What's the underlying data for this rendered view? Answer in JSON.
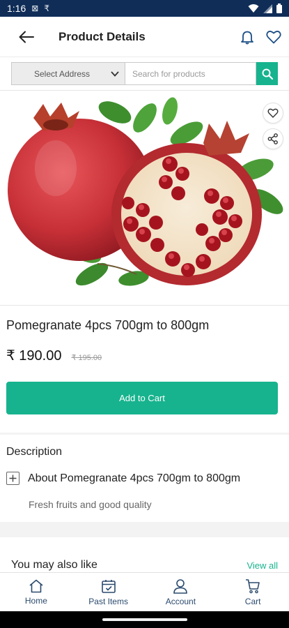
{
  "status_bar": {
    "time": "1:16",
    "notification_glyphs": [
      "⊠",
      "₹"
    ]
  },
  "header": {
    "title": "Product Details",
    "icons": {
      "back": "arrow-left-icon",
      "notifications": "bell-icon",
      "wishlist": "heart-icon"
    }
  },
  "search": {
    "address_label": "Select Address",
    "placeholder": "Search for products",
    "value": ""
  },
  "product": {
    "name": "Pomegranate 4pcs 700gm to 800gm",
    "price": "₹ 190.00",
    "original_price": "₹ 195.00",
    "add_to_cart_label": "Add to Cart"
  },
  "description": {
    "title": "Description",
    "heading": "About Pomegranate 4pcs 700gm to 800gm",
    "body": "Fresh fruits and good quality"
  },
  "recommendations": {
    "title": "You may also like",
    "view_all_label": "View all"
  },
  "bottom_nav": {
    "items": [
      {
        "label": "Home",
        "icon": "home-icon"
      },
      {
        "label": "Past Items",
        "icon": "past-items-icon"
      },
      {
        "label": "Account",
        "icon": "account-icon"
      },
      {
        "label": "Cart",
        "icon": "cart-icon"
      }
    ]
  },
  "colors": {
    "accent": "#17b38e",
    "status_bar": "#0f2d57",
    "nav_text": "#2a4a6d"
  }
}
